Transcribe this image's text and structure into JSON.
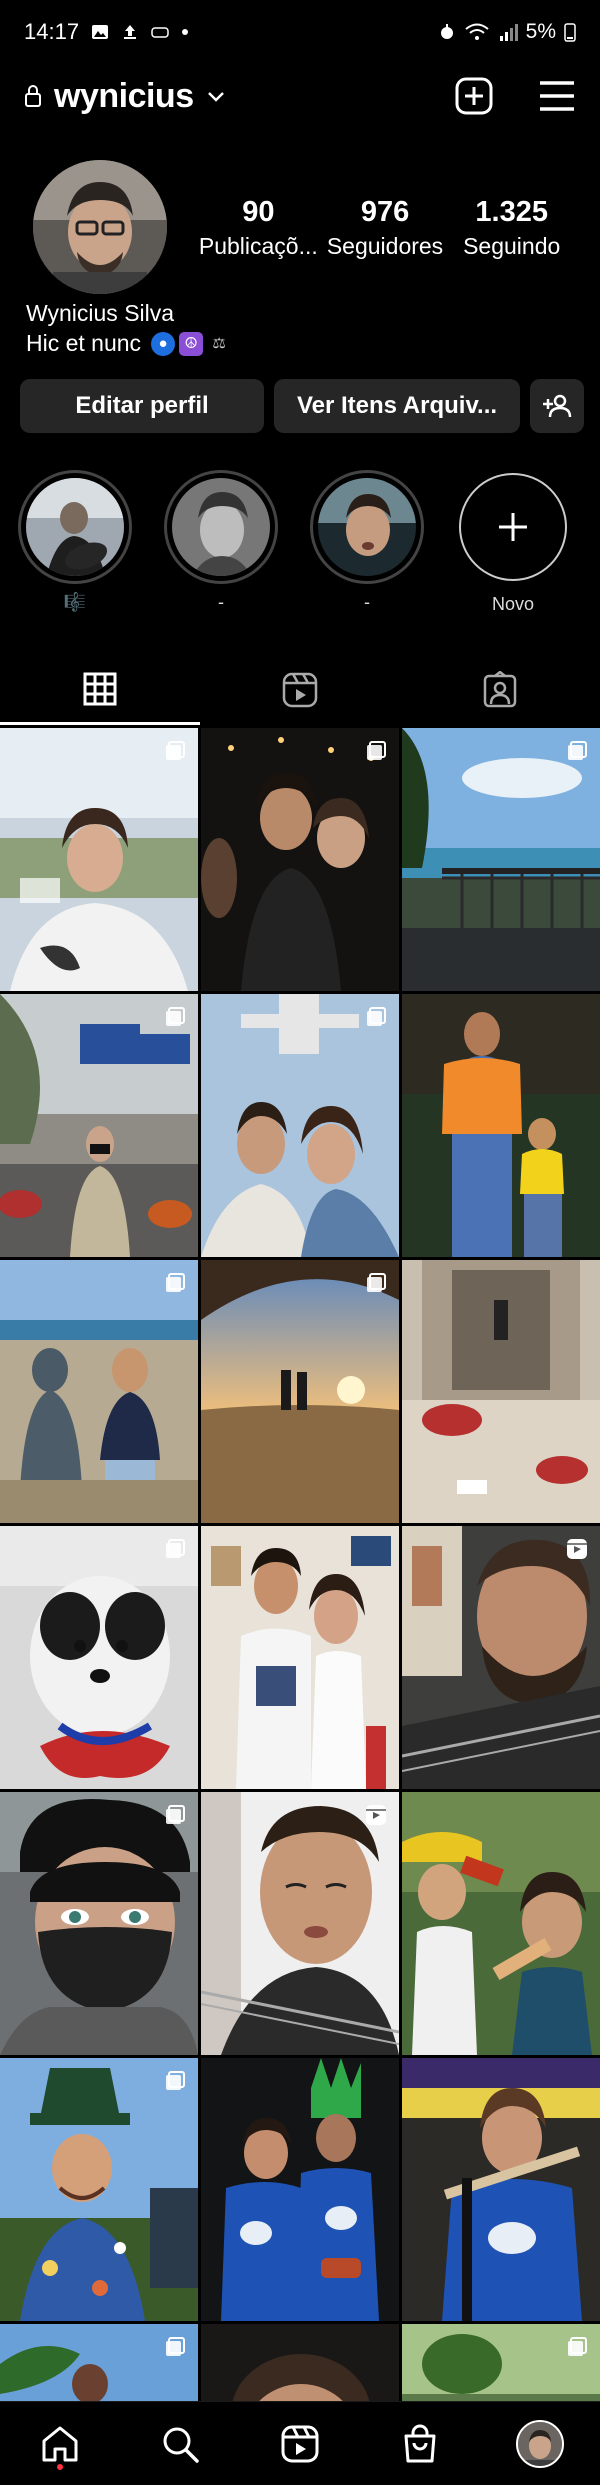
{
  "status_bar": {
    "time": "14:17",
    "battery": "5%"
  },
  "header": {
    "username": "wynicius"
  },
  "profile": {
    "posts_count": "90",
    "posts_label": "Publicaçõ...",
    "followers_count": "976",
    "followers_label": "Seguidores",
    "following_count": "1.325",
    "following_label": "Seguindo",
    "display_name": "Wynicius Silva",
    "bio_text": "Hic et nunc"
  },
  "buttons": {
    "edit_profile": "Editar perfil",
    "archive": "Ver Itens Arquiv..."
  },
  "highlights": [
    {
      "label": "🎼"
    },
    {
      "label": "-"
    },
    {
      "label": "-"
    }
  ],
  "new_highlight_label": "Novo",
  "colors": {
    "background": "#000000",
    "button": "#262626",
    "accent_dot": "#ff3040"
  }
}
